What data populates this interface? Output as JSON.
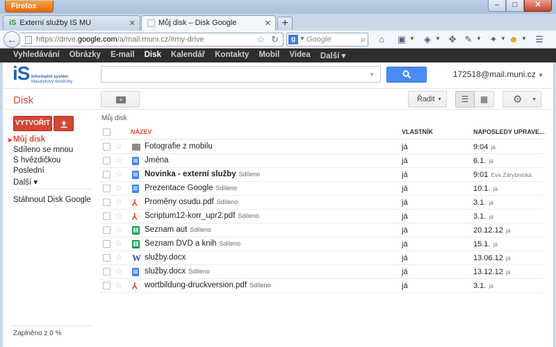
{
  "browser": {
    "menu_button": "Firefox",
    "tabs": [
      {
        "favicon": "iS",
        "title": "Externí služby IS MU"
      },
      {
        "favicon": "",
        "title": "Můj disk – Disk Google"
      }
    ],
    "url_prefix": "https://drive.",
    "url_host": "google.com",
    "url_path": "/a/mail.muni.cz/#my-drive",
    "search_engine": "g",
    "search_placeholder": "Google"
  },
  "gbar": {
    "items": [
      "Vyhledávání",
      "Obrázky",
      "E-mail",
      "Disk",
      "Kalendář",
      "Kontakty",
      "Mobil",
      "Videa",
      "Další ▾"
    ],
    "active_index": 3
  },
  "header": {
    "logo_mark": "iS",
    "logo_line1": "Informační systém",
    "logo_line2": "Masarykovy univerzity",
    "account": "172518@mail.muni.cz"
  },
  "toolbar": {
    "title": "Disk",
    "sort_label": "Řadit"
  },
  "sidebar": {
    "create_label": "VYTVOŘIT",
    "items": [
      "Můj disk",
      "Sdíleno se mnou",
      "S hvězdičkou",
      "Poslední",
      "Další ▾"
    ],
    "download_label": "Stáhnout Disk Google",
    "quota": "Zaplněno z 0 %"
  },
  "filelist": {
    "breadcrumb": "Můj disk",
    "columns": {
      "name": "NÁZEV",
      "owner": "VLASTNÍK",
      "modified": "NAPOSLEDY UPRAVE..."
    },
    "rows": [
      {
        "icon": "folder",
        "name": "Fotografie z mobilu",
        "shared": "",
        "bold": false,
        "owner": "já",
        "modified": "9:04",
        "by": "já"
      },
      {
        "icon": "doc",
        "name": "Jména",
        "shared": "",
        "bold": false,
        "owner": "já",
        "modified": "6.1.",
        "by": "já"
      },
      {
        "icon": "doc",
        "name": "Novinka - externí služby",
        "shared": "Sdíleno",
        "bold": true,
        "owner": "já",
        "modified": "9:01",
        "by": "Eva Zárybnická"
      },
      {
        "icon": "slides",
        "name": "Prezentace Google",
        "shared": "Sdíleno",
        "bold": false,
        "owner": "já",
        "modified": "10.1.",
        "by": "já"
      },
      {
        "icon": "pdf",
        "name": "Proměny osudu.pdf",
        "shared": "Sdíleno",
        "bold": false,
        "owner": "já",
        "modified": "3.1.",
        "by": "já"
      },
      {
        "icon": "pdf",
        "name": "Scriptum12-korr_upr2.pdf",
        "shared": "Sdíleno",
        "bold": false,
        "owner": "já",
        "modified": "3.1.",
        "by": "já"
      },
      {
        "icon": "sheet",
        "name": "Seznam aut",
        "shared": "Sdíleno",
        "bold": false,
        "owner": "já",
        "modified": "20.12.12",
        "by": "já"
      },
      {
        "icon": "sheet",
        "name": "Seznam DVD a knih",
        "shared": "Sdíleno",
        "bold": false,
        "owner": "já",
        "modified": "15.1.",
        "by": "já"
      },
      {
        "icon": "word",
        "name": "služby.docx",
        "shared": "",
        "bold": false,
        "owner": "já",
        "modified": "13.06.12",
        "by": "já"
      },
      {
        "icon": "doc",
        "name": "služby.docx",
        "shared": "Sdíleno",
        "bold": false,
        "owner": "já",
        "modified": "13.12.12",
        "by": "já"
      },
      {
        "icon": "pdf",
        "name": "wortbildung-druckversion.pdf",
        "shared": "Sdíleno",
        "bold": false,
        "owner": "já",
        "modified": "3.1.",
        "by": "já"
      }
    ]
  }
}
